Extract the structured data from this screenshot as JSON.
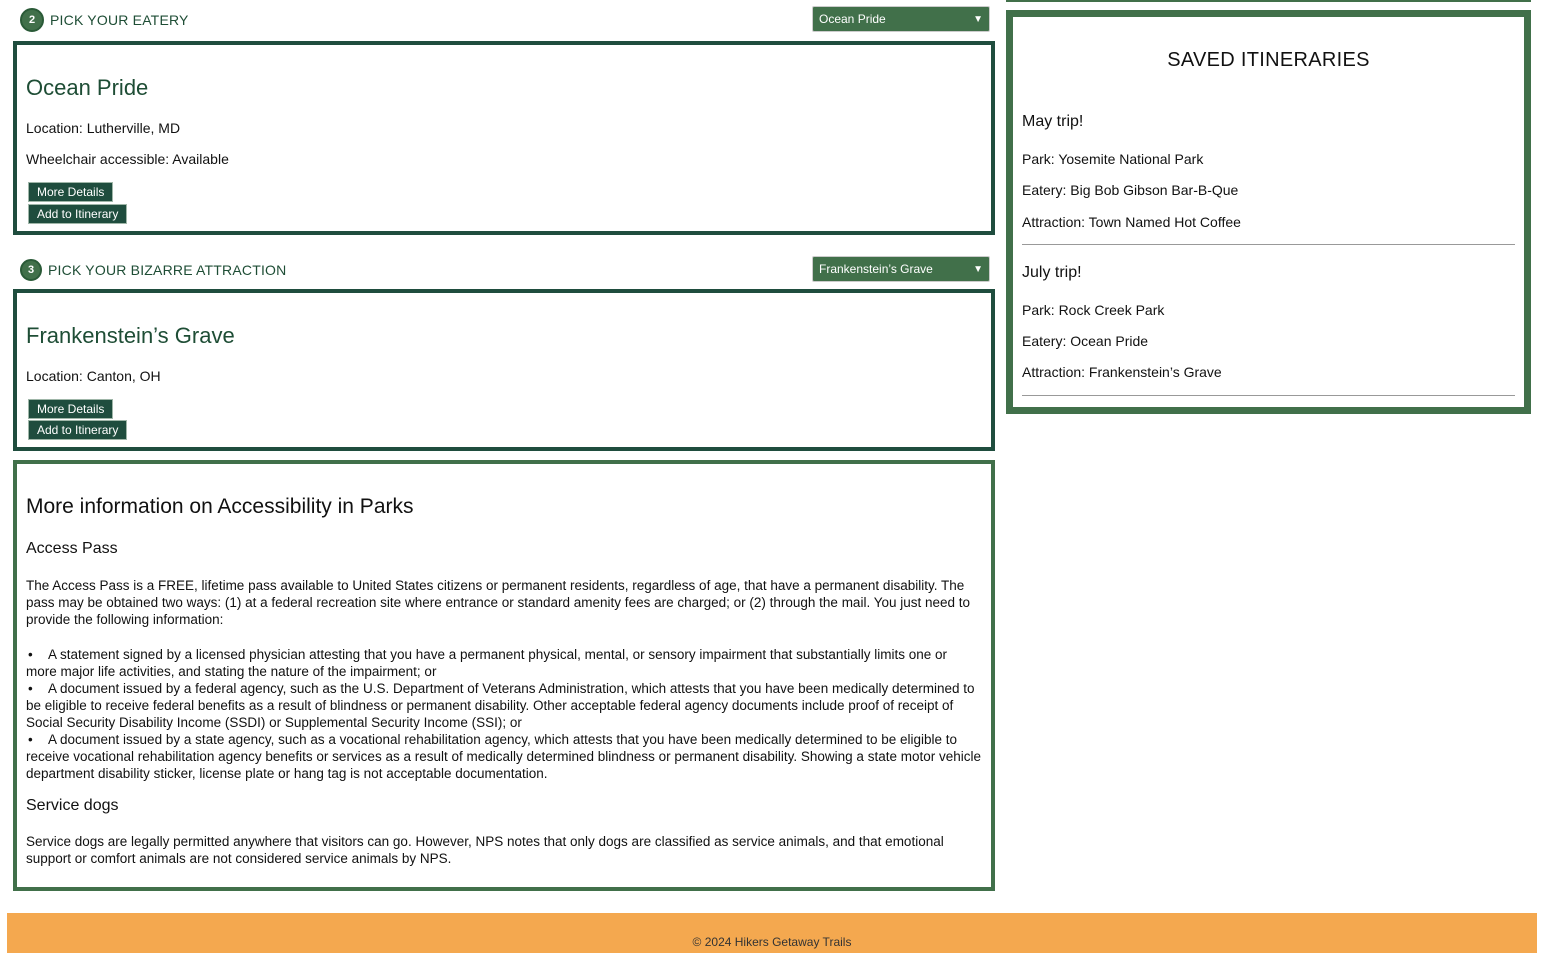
{
  "eatery_section": {
    "step": "2",
    "label": "PICK YOUR EATERY",
    "selected": "Ocean Pride",
    "card": {
      "title": "Ocean Pride",
      "location": "Location: Lutherville, MD",
      "wheelchair": "Wheelchair accessible: Available",
      "details_btn": "More Details",
      "add_btn": "Add to Itinerary"
    }
  },
  "attraction_section": {
    "step": "3",
    "label": "PICK YOUR BIZARRE ATTRACTION",
    "selected": "Frankenstein’s Grave",
    "card": {
      "title": "Frankenstein’s Grave",
      "location": "Location: Canton, OH",
      "details_btn": "More Details",
      "add_btn": "Add to Itinerary"
    }
  },
  "info": {
    "title": "More information on Accessibility in Parks",
    "access_heading": "Access Pass",
    "access_text": "The Access Pass is a FREE, lifetime pass available to United States citizens or permanent residents, regardless of age, that have a permanent disability. The pass may be obtained two ways: (1) at a federal recreation site where entrance or standard amenity fees are charged; or (2) through the mail. You just need to provide the following information:",
    "bullets": [
      "A statement signed by a licensed physician attesting that you have a permanent physical, mental, or sensory impairment that substantially limits one or more major life activities, and stating the nature of the impairment; or",
      "A document issued by a federal agency, such as the U.S. Department of Veterans Administration, which attests that you have been medically determined to be eligible to receive federal benefits as a result of blindness or permanent disability. Other acceptable federal agency documents include proof of receipt of Social Security Disability Income (SSDI) or Supplemental Security Income (SSI); or",
      "A document issued by a state agency, such as a vocational rehabilitation agency, which attests that you have been medically determined to be eligible to receive vocational rehabilitation agency benefits or services as a result of medically determined blindness or permanent disability. Showing a state motor vehicle department disability sticker, license plate or hang tag is not acceptable documentation."
    ],
    "dogs_heading": "Service dogs",
    "dogs_text": "Service dogs are legally permitted anywhere that visitors can go. However, NPS notes that only dogs are classified as service animals, and that emotional support or comfort animals are not considered service animals by NPS."
  },
  "saved": {
    "title": "SAVED ITINERARIES",
    "trips": [
      {
        "name": "May trip!",
        "park": "Park: Yosemite National Park",
        "eatery": "Eatery: Big Bob Gibson Bar-B-Que",
        "attraction": "Attraction: Town Named Hot Coffee"
      },
      {
        "name": "July trip!",
        "park": "Park: Rock Creek Park",
        "eatery": "Eatery: Ocean Pride",
        "attraction": "Attraction: Frankenstein’s Grave"
      }
    ]
  },
  "footer": {
    "text": "© 2024 Hikers Getaway Trails"
  },
  "colors": {
    "dark_green": "#1f4d3e",
    "green": "#41704a",
    "footer_orange": "#f4a84f"
  }
}
